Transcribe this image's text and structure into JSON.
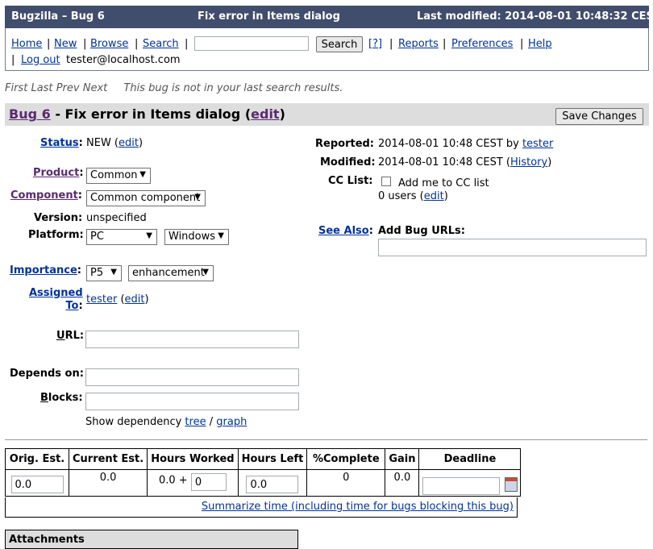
{
  "titlebar": {
    "app": "Bugzilla – Bug 6",
    "center": "Fix error in Items dialog",
    "modified": "Last modified: 2014-08-01 10:48:32 CEST"
  },
  "nav": {
    "home": "Home",
    "new": "New",
    "browse": "Browse",
    "search": "Search",
    "search_value": "",
    "search_button": "Search",
    "help_q": "[?]",
    "reports": "Reports",
    "preferences": "Preferences",
    "help": "Help",
    "logout": "Log out",
    "user": "tester@localhost.com",
    "sep": "|"
  },
  "navlinks": {
    "first": "First",
    "last": "Last",
    "prev": "Prev",
    "next": "Next",
    "msg": "This bug is not in your last search results."
  },
  "bug": {
    "link": "Bug 6",
    "dash": " - ",
    "summary": "Fix error in Items dialog",
    "edit": "edit",
    "save": "Save Changes"
  },
  "fields": {
    "status_label": "Status",
    "status_value": "NEW",
    "edit": "edit",
    "product_label": "Product",
    "product_value": "Common",
    "component_label": "Component",
    "component_value": "Common component",
    "version_label": "Version:",
    "version_value": "unspecified",
    "platform_label": "Platform:",
    "platform_value": "PC",
    "os_value": "Windows",
    "importance_label": "Importance",
    "priority_value": "P5",
    "severity_value": "enhancement",
    "assigned_label1": "Assigned",
    "assigned_label2": "To",
    "assigned_value": "tester",
    "url_label_u": "U",
    "url_label_rest": "RL:",
    "url_value": "",
    "depends_label": "Depends on:",
    "depends_value": "",
    "blocks_label_b": "B",
    "blocks_label_rest": "locks:",
    "blocks_value": "",
    "dep_text": "Show dependency",
    "dep_tree": "tree",
    "dep_slash": "/",
    "dep_graph": "graph"
  },
  "right": {
    "reported_label": "Reported:",
    "reported_value": "2014-08-01 10:48 CEST by",
    "reported_by": "tester",
    "modified_label": "Modified:",
    "modified_value": "2014-08-01 10:48 CEST (",
    "history": "History",
    "close_paren": ")",
    "cc_label": "CC List:",
    "cc_add": "Add me to CC list",
    "cc_count": "0 users",
    "edit": "edit",
    "seealso_label": "See Also",
    "addurl_label": "Add Bug URLs:",
    "addurl_value": ""
  },
  "time": {
    "headers": [
      "Orig. Est.",
      "Current Est.",
      "Hours Worked",
      "Hours Left",
      "%Complete",
      "Gain",
      "Deadline"
    ],
    "orig": "0.0",
    "current": "0.0",
    "worked": "0.0 +",
    "worked_input": "0",
    "left": "0.0",
    "complete": "0",
    "gain": "0.0",
    "deadline": "",
    "summarize": "Summarize time (including time for bugs blocking this bug)"
  },
  "attachments": {
    "title": "Attachments"
  },
  "icons": {
    "calendar": "calendar-icon"
  }
}
